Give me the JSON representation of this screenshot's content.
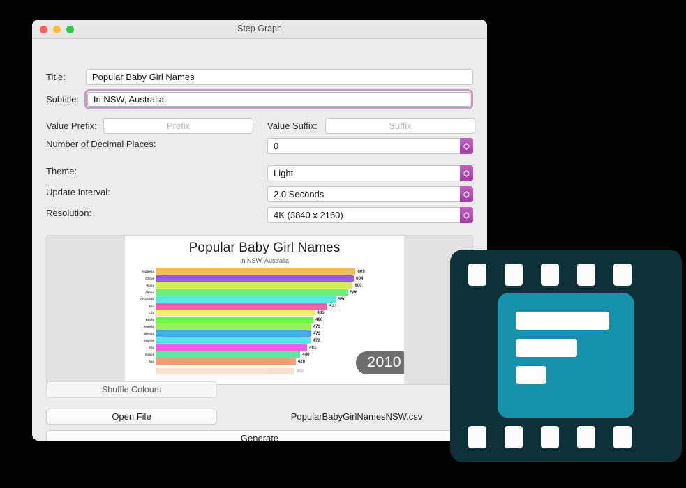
{
  "window": {
    "title": "Step Graph",
    "traffic_lights": [
      "close-button",
      "minimize-button",
      "zoom-button"
    ]
  },
  "form": {
    "title_label": "Title:",
    "title_value": "Popular Baby Girl Names",
    "subtitle_label": "Subtitle:",
    "subtitle_value": "In NSW, Australia",
    "value_prefix_label": "Value Prefix:",
    "value_prefix_placeholder": "Prefix",
    "value_prefix_value": "",
    "value_suffix_label": "Value Suffix:",
    "value_suffix_placeholder": "Suffix",
    "value_suffix_value": "",
    "decimals_label": "Number of Decimal Places:",
    "decimals_value": "0",
    "theme_label": "Theme:",
    "theme_value": "Light",
    "interval_label": "Update Interval:",
    "interval_value": "2.0 Seconds",
    "resolution_label": "Resolution:",
    "resolution_value": "4K (3840 x 2160)"
  },
  "actions": {
    "shuffle_label": "Shuffle Colours",
    "open_file_label": "Open File",
    "filename": "PopularBabyGirlNamesNSW.csv",
    "generate_label": "Generate"
  },
  "chart_data": {
    "type": "bar",
    "orientation": "horizontal",
    "title": "Popular Baby Girl Names",
    "subtitle": "In NSW, Australia",
    "xlabel": "",
    "ylabel": "",
    "axis_origin_tick": "0",
    "year_badge": "2010",
    "xlim": [
      0,
      640
    ],
    "grid": false,
    "legend": "none",
    "categories": [
      "Isabella",
      "Chloe",
      "Ruby",
      "Olivia",
      "Charlotte",
      "Mia",
      "Lily",
      "Emily",
      "Amelia",
      "Sienna",
      "Sophie",
      "Ella",
      "Grace",
      "Ava"
    ],
    "values": [
      609,
      604,
      600,
      586,
      550,
      523,
      485,
      480,
      473,
      473,
      472,
      461,
      440,
      426
    ],
    "colors": [
      "#f2bd5c",
      "#9b59e8",
      "#d6ec5d",
      "#6ded7a",
      "#55ebe0",
      "#f760b0",
      "#f2ee63",
      "#7ced52",
      "#9aef5e",
      "#4aa8e8",
      "#56e8ee",
      "#ee5ef0",
      "#56e8a0",
      "#f0a173"
    ],
    "incoming_bar": {
      "value": 422,
      "color": "#f0a173",
      "opacity": 0.3
    }
  }
}
